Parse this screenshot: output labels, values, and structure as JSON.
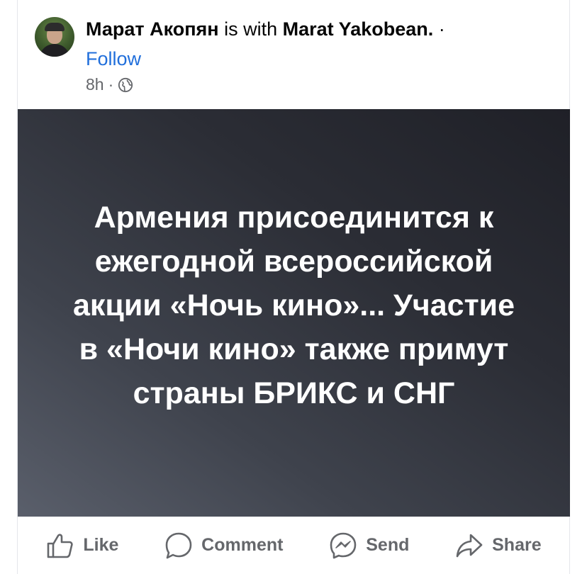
{
  "post": {
    "author": "Марат Акопян",
    "with_text": "is with",
    "tagged": "Marat Yakobean.",
    "separator": "·",
    "follow_label": "Follow",
    "time": "8h",
    "time_separator": "·",
    "audience_icon": "globe-icon",
    "image_text": "Армения присоединится к ежегодной всероссийской акции «Ночь кино»... Участие в «Ночи кино» также примут страны БРИКС и СНГ"
  },
  "actions": {
    "like": "Like",
    "comment": "Comment",
    "send": "Send",
    "share": "Share"
  },
  "colors": {
    "link_blue": "#216fdb",
    "text_secondary": "#65676b",
    "text_primary": "#050505"
  }
}
